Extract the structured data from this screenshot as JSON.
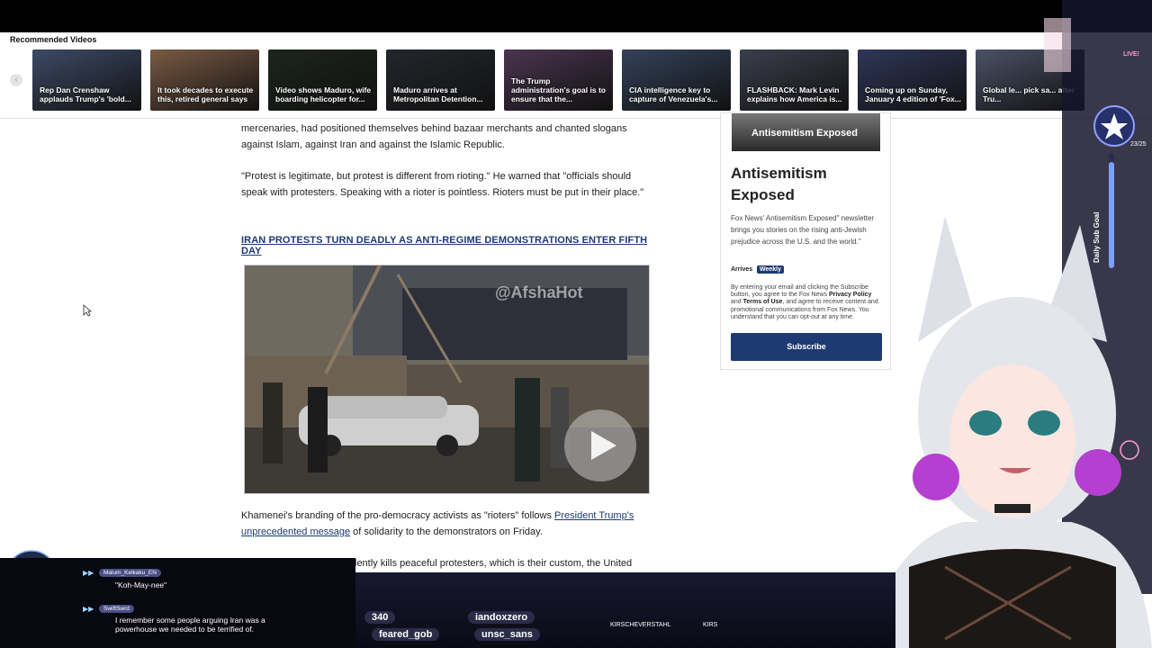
{
  "recommended": {
    "label": "Recommended Videos",
    "videos": [
      {
        "caption": "Rep Dan Crenshaw applauds Trump's 'bold...",
        "color": "#3d4a66"
      },
      {
        "caption": "It took decades to execute this, retired general says",
        "color": "#7a5a44"
      },
      {
        "caption": "Video shows Maduro, wife boarding helicopter for...",
        "color": "#1c241c"
      },
      {
        "caption": "Maduro arrives at Metropolitan Detention...",
        "color": "#23262c"
      },
      {
        "caption": "The Trump administration's goal is to ensure that the...",
        "color": "#4a3550"
      },
      {
        "caption": "CIA intelligence key to capture of Venezuela's...",
        "color": "#34425a"
      },
      {
        "caption": "FLASHBACK: Mark Levin explains how America is...",
        "color": "#3b3f4c"
      },
      {
        "caption": "Coming up on Sunday, January 4 edition of 'Fox...",
        "color": "#2f3658"
      },
      {
        "caption": "Global le... pick sa... after Tru...",
        "color": "#4b5266"
      }
    ]
  },
  "article": {
    "para1": "mercenaries, had positioned themselves behind bazaar merchants and chanted slogans against Islam, against Iran and against the Islamic Republic.",
    "para2": "\"Protest is legitimate, but protest is different from rioting.\" He warned that \"officials should speak with protesters. Speaking with a rioter is pointless. Rioters must be put in their place.\"",
    "headline_link": "IRAN PROTESTS TURN DEADLY AS ANTI-REGIME DEMONSTRATIONS ENTER FIFTH DAY",
    "video_watermark": "@AfshaHot",
    "para3_start": "Khamenei's branding of the pro-democracy activists as \"rioters\" follows ",
    "para3_link": "President Trump's unprecedented message",
    "para3_end": " of solidarity to the demonstrators on Friday.",
    "para4_partial": "lently kills peaceful protesters, which is their custom, the United"
  },
  "newsletter": {
    "banner": "Antisemitism Exposed",
    "title": "Antisemitism Exposed",
    "description": "Fox News' Antisemitism Exposed\" newsletter brings you stories on the rising anti-Jewish prejudice across the U.S. and the world.\"",
    "arrives_label": "Arrives",
    "frequency": "Weekly",
    "legal_start": "By entering your email and clicking the Subscribe button, you agree to the Fox News ",
    "privacy": "Privacy Policy",
    "legal_and": " and ",
    "terms": "Terms of Use",
    "legal_end": ", and agree to receive content and promotional communications from Fox News. You understand that you can opt-out at any time.",
    "subscribe_label": "Subscribe",
    "accent": "#1d3a73"
  },
  "stream": {
    "chat": [
      {
        "user": "Malum_Kelkaku_EN",
        "message": "\"Koh-May-nee\""
      },
      {
        "user": "SwiftSwrd",
        "message": "I remember some people arguing Iran was a powerhouse we needed to be terrified of."
      }
    ],
    "ticker": {
      "count": "340",
      "names": [
        "iandoxzero",
        "feared_gob",
        "unsc_sans"
      ],
      "mini": [
        "KIRSCHEVERSTAHL",
        "KIRS"
      ]
    },
    "live_label": "LIVE!",
    "goal_label": "Daily Sub Goal",
    "goal_count": "23/25"
  }
}
